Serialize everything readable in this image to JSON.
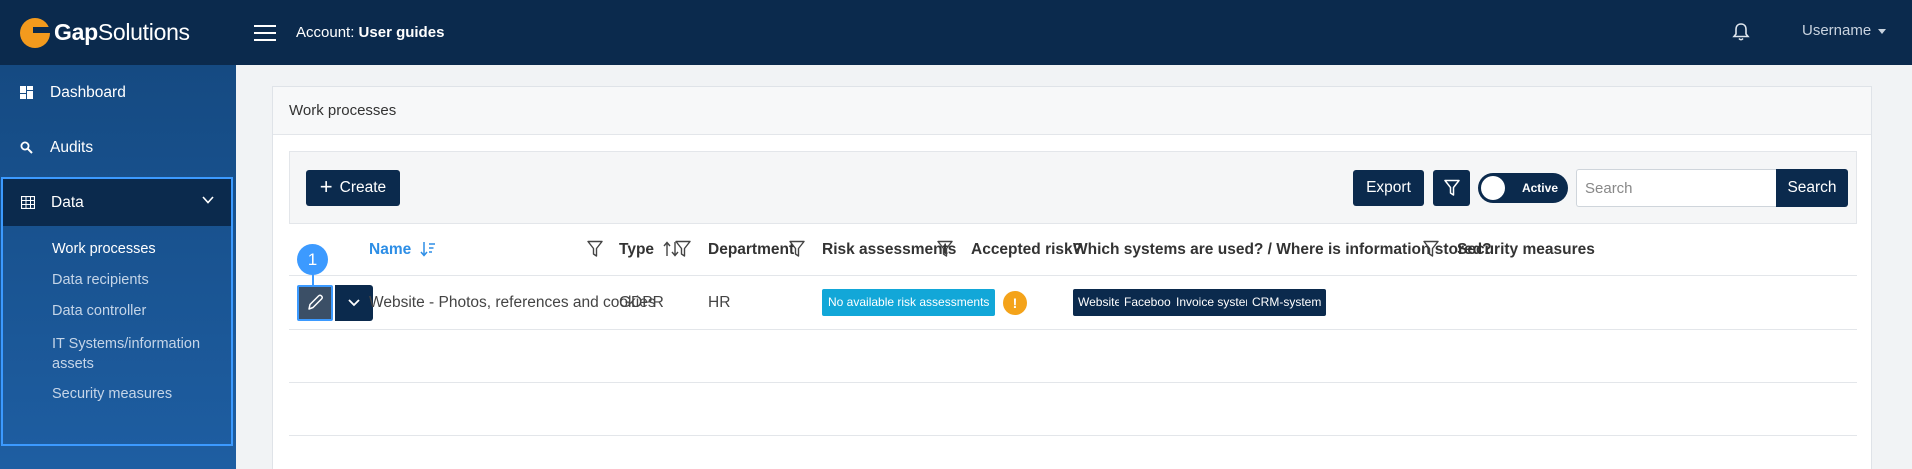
{
  "header": {
    "logo_bold": "Gap",
    "logo_rest": "Solutions",
    "account_label": "Account:",
    "account_name": "User guides",
    "username": "Username",
    "icons": [
      "menu-icon",
      "bell-icon"
    ]
  },
  "sidebar": {
    "items": [
      {
        "label": "Dashboard",
        "icon": "dashboard-icon"
      },
      {
        "label": "Audits",
        "icon": "search-icon"
      }
    ],
    "data_group": {
      "label": "Data",
      "icon": "table-icon",
      "expanded": true,
      "children": [
        {
          "label": "Work processes",
          "active": true
        },
        {
          "label": "Data recipients",
          "active": false
        },
        {
          "label": "Data controller",
          "active": false
        },
        {
          "label": "IT Systems/information assets",
          "active": false
        },
        {
          "label": "Security measures",
          "active": false
        }
      ]
    }
  },
  "main": {
    "title": "Work processes",
    "toolbar": {
      "create_label": "Create",
      "export_label": "Export",
      "toggle_label": "Active",
      "toggle_on": true,
      "search_placeholder": "Search",
      "search_button": "Search"
    },
    "table": {
      "columns": {
        "name": "Name",
        "type": "Type",
        "department": "Department",
        "risk": "Risk assessments",
        "accepted": "Accepted risk?",
        "systems": "Which systems are used? / Where is information stored?",
        "security": "Security measures"
      },
      "sort": {
        "column": "name",
        "direction": "desc"
      },
      "rows": [
        {
          "marker": "1",
          "name": "Website - Photos, references and cookies",
          "type": "GDPR",
          "department": "HR",
          "risk": "No available risk assessments",
          "accepted": "!",
          "systems": [
            "Website",
            "Facebook",
            "Invoice system",
            "CRM-system"
          ],
          "security": ""
        }
      ]
    }
  },
  "colors": {
    "navy": "#0b2a4d",
    "sidebar": "#1e5ea2",
    "accent": "#3c9aff",
    "sorted_header": "#2d8ee6",
    "badge_blue": "#12a7d8",
    "warning": "#f4a31a",
    "logo_orange": "#f39a1d"
  }
}
